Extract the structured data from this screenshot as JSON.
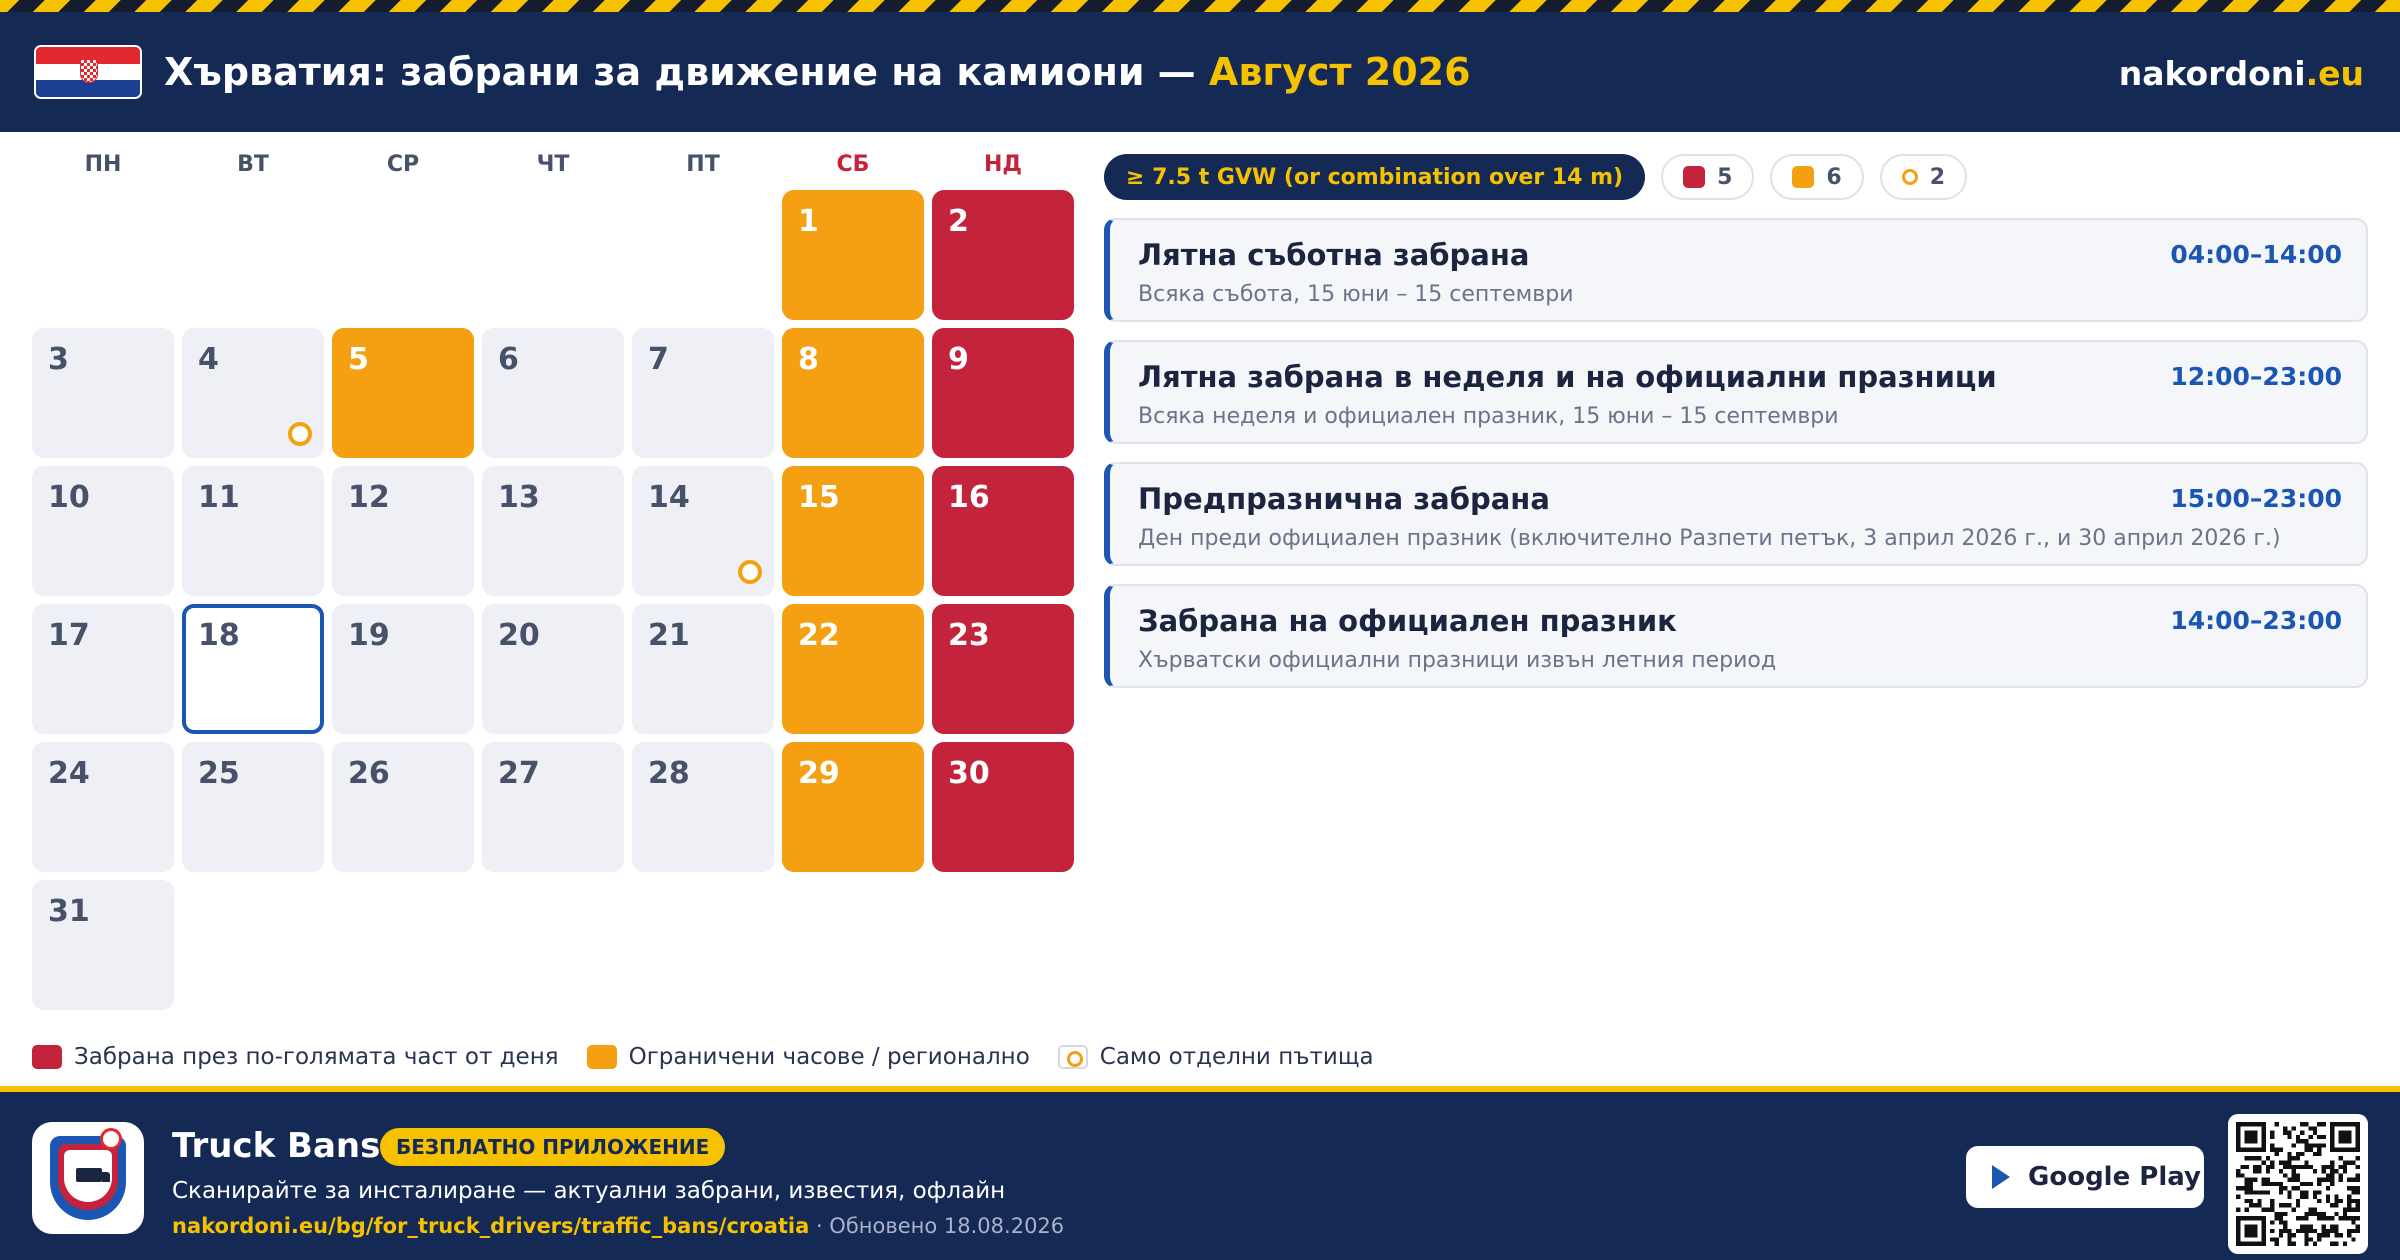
{
  "header": {
    "title": "Хърватия: забрани за движение на камиони —",
    "title_highlight": "Август 2026",
    "brand_main": "nakordoni",
    "brand_tld": ".eu",
    "flag_icon": "croatia-flag-icon"
  },
  "calendar": {
    "weekdays": [
      "ПН",
      "ВТ",
      "СР",
      "ЧТ",
      "ПТ",
      "СБ",
      "НД"
    ],
    "days": [
      {
        "d": "1",
        "type": "sat"
      },
      {
        "d": "2",
        "type": "sun"
      },
      {
        "d": "3",
        "type": "normal"
      },
      {
        "d": "4",
        "type": "normal",
        "ring": true
      },
      {
        "d": "5",
        "type": "sat"
      },
      {
        "d": "6",
        "type": "normal"
      },
      {
        "d": "7",
        "type": "normal"
      },
      {
        "d": "8",
        "type": "sat"
      },
      {
        "d": "9",
        "type": "sun"
      },
      {
        "d": "10",
        "type": "normal"
      },
      {
        "d": "11",
        "type": "normal"
      },
      {
        "d": "12",
        "type": "normal"
      },
      {
        "d": "13",
        "type": "normal"
      },
      {
        "d": "14",
        "type": "normal",
        "ring": true
      },
      {
        "d": "15",
        "type": "sat"
      },
      {
        "d": "16",
        "type": "sun"
      },
      {
        "d": "17",
        "type": "normal"
      },
      {
        "d": "18",
        "type": "today"
      },
      {
        "d": "19",
        "type": "normal"
      },
      {
        "d": "20",
        "type": "normal"
      },
      {
        "d": "21",
        "type": "normal"
      },
      {
        "d": "22",
        "type": "sat"
      },
      {
        "d": "23",
        "type": "sun"
      },
      {
        "d": "24",
        "type": "normal"
      },
      {
        "d": "25",
        "type": "normal"
      },
      {
        "d": "26",
        "type": "normal"
      },
      {
        "d": "27",
        "type": "normal"
      },
      {
        "d": "28",
        "type": "normal"
      },
      {
        "d": "29",
        "type": "sat"
      },
      {
        "d": "30",
        "type": "sun"
      },
      {
        "d": "31",
        "type": "normal"
      }
    ]
  },
  "legend": {
    "full_day": "Забрана през по-голямата част от деня",
    "limited": "Ограничени часове / регионално",
    "roads": "Само отделни пътища"
  },
  "chips": {
    "vehicle": "≥ 7.5 t GVW (or combination over 14 m)",
    "red_count": "5",
    "orange_count": "6",
    "ring_count": "2"
  },
  "rules": [
    {
      "title": "Лятна съботна забрана",
      "subtitle": "Всяка събота, 15 юни – 15 септември",
      "hours": "04:00–14:00"
    },
    {
      "title": "Лятна забрана в неделя и на официални празници",
      "subtitle": "Всяка неделя и официален празник, 15 юни – 15 септември",
      "hours": "12:00–23:00"
    },
    {
      "title": "Предпразнична забрана",
      "subtitle": "Ден преди официален празник (включително Разпети петък, 3 април 2026 г., и 30 април 2026 г.)",
      "hours": "15:00–23:00"
    },
    {
      "title": "Забрана на официален празник",
      "subtitle": "Хърватски официални празници извън летния период",
      "hours": "14:00–23:00"
    }
  ],
  "footer": {
    "app_name": "Truck Bans",
    "badge": "БЕЗПЛАТНО ПРИЛОЖЕНИЕ",
    "tagline": "Сканирайте за инсталиране — актуални забрани, известия, офлайн",
    "link": "nakordoni.eu/bg/for_truck_drivers/traffic_bans/croatia",
    "updated": " · Обновено 18.08.2026",
    "store_label": "Google Play"
  },
  "colors": {
    "navy": "#142a55",
    "yellow": "#f6c200",
    "red": "#c4233c",
    "orange": "#f4a012",
    "blue": "#1a56b2"
  }
}
